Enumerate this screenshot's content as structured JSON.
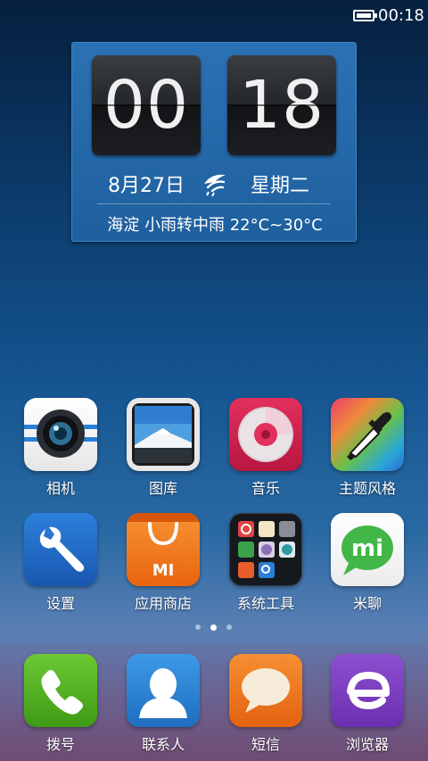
{
  "status_bar": {
    "time": "00:18",
    "battery_icon": "battery-full-icon"
  },
  "widget": {
    "hour": "00",
    "minute": "18",
    "date": "8月27日",
    "weekday": "星期二",
    "weather_icon": "weather-logo-icon",
    "weather": "海淀  小雨转中雨  22°C~30°C"
  },
  "apps_row1": [
    {
      "label": "相机",
      "icon": "camera-icon"
    },
    {
      "label": "图库",
      "icon": "gallery-icon"
    },
    {
      "label": "音乐",
      "icon": "music-icon"
    },
    {
      "label": "主题风格",
      "icon": "theme-icon"
    }
  ],
  "apps_row2": [
    {
      "label": "设置",
      "icon": "settings-icon"
    },
    {
      "label": "应用商店",
      "icon": "app-store-icon"
    },
    {
      "label": "系统工具",
      "icon": "system-tools-folder-icon"
    },
    {
      "label": "米聊",
      "icon": "miliao-icon"
    }
  ],
  "pager": {
    "pages": 3,
    "current": 2
  },
  "dock": [
    {
      "label": "拨号",
      "icon": "phone-icon"
    },
    {
      "label": "联系人",
      "icon": "contacts-icon"
    },
    {
      "label": "短信",
      "icon": "sms-icon"
    },
    {
      "label": "浏览器",
      "icon": "browser-icon"
    }
  ],
  "colors": {
    "widget_bg": "#2468aa",
    "music": "#d7204f",
    "settings": "#1f6ec9",
    "app_store": "#f07a1a",
    "phone": "#4cad1e",
    "contacts": "#2a86d6",
    "sms": "#f07b1d",
    "browser": "#7c3fc0"
  }
}
